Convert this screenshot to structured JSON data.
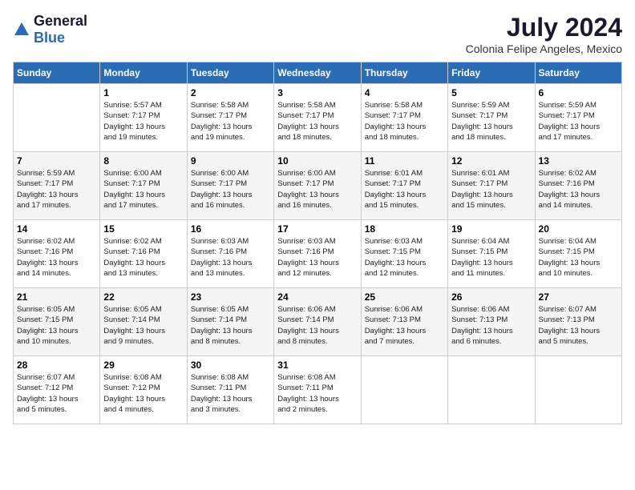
{
  "logo": {
    "general": "General",
    "blue": "Blue"
  },
  "title": "July 2024",
  "location": "Colonia Felipe Angeles, Mexico",
  "days_of_week": [
    "Sunday",
    "Monday",
    "Tuesday",
    "Wednesday",
    "Thursday",
    "Friday",
    "Saturday"
  ],
  "weeks": [
    [
      {
        "day": "",
        "info": ""
      },
      {
        "day": "1",
        "info": "Sunrise: 5:57 AM\nSunset: 7:17 PM\nDaylight: 13 hours\nand 19 minutes."
      },
      {
        "day": "2",
        "info": "Sunrise: 5:58 AM\nSunset: 7:17 PM\nDaylight: 13 hours\nand 19 minutes."
      },
      {
        "day": "3",
        "info": "Sunrise: 5:58 AM\nSunset: 7:17 PM\nDaylight: 13 hours\nand 18 minutes."
      },
      {
        "day": "4",
        "info": "Sunrise: 5:58 AM\nSunset: 7:17 PM\nDaylight: 13 hours\nand 18 minutes."
      },
      {
        "day": "5",
        "info": "Sunrise: 5:59 AM\nSunset: 7:17 PM\nDaylight: 13 hours\nand 18 minutes."
      },
      {
        "day": "6",
        "info": "Sunrise: 5:59 AM\nSunset: 7:17 PM\nDaylight: 13 hours\nand 17 minutes."
      }
    ],
    [
      {
        "day": "7",
        "info": "Sunrise: 5:59 AM\nSunset: 7:17 PM\nDaylight: 13 hours\nand 17 minutes."
      },
      {
        "day": "8",
        "info": "Sunrise: 6:00 AM\nSunset: 7:17 PM\nDaylight: 13 hours\nand 17 minutes."
      },
      {
        "day": "9",
        "info": "Sunrise: 6:00 AM\nSunset: 7:17 PM\nDaylight: 13 hours\nand 16 minutes."
      },
      {
        "day": "10",
        "info": "Sunrise: 6:00 AM\nSunset: 7:17 PM\nDaylight: 13 hours\nand 16 minutes."
      },
      {
        "day": "11",
        "info": "Sunrise: 6:01 AM\nSunset: 7:17 PM\nDaylight: 13 hours\nand 15 minutes."
      },
      {
        "day": "12",
        "info": "Sunrise: 6:01 AM\nSunset: 7:17 PM\nDaylight: 13 hours\nand 15 minutes."
      },
      {
        "day": "13",
        "info": "Sunrise: 6:02 AM\nSunset: 7:16 PM\nDaylight: 13 hours\nand 14 minutes."
      }
    ],
    [
      {
        "day": "14",
        "info": "Sunrise: 6:02 AM\nSunset: 7:16 PM\nDaylight: 13 hours\nand 14 minutes."
      },
      {
        "day": "15",
        "info": "Sunrise: 6:02 AM\nSunset: 7:16 PM\nDaylight: 13 hours\nand 13 minutes."
      },
      {
        "day": "16",
        "info": "Sunrise: 6:03 AM\nSunset: 7:16 PM\nDaylight: 13 hours\nand 13 minutes."
      },
      {
        "day": "17",
        "info": "Sunrise: 6:03 AM\nSunset: 7:16 PM\nDaylight: 13 hours\nand 12 minutes."
      },
      {
        "day": "18",
        "info": "Sunrise: 6:03 AM\nSunset: 7:15 PM\nDaylight: 13 hours\nand 12 minutes."
      },
      {
        "day": "19",
        "info": "Sunrise: 6:04 AM\nSunset: 7:15 PM\nDaylight: 13 hours\nand 11 minutes."
      },
      {
        "day": "20",
        "info": "Sunrise: 6:04 AM\nSunset: 7:15 PM\nDaylight: 13 hours\nand 10 minutes."
      }
    ],
    [
      {
        "day": "21",
        "info": "Sunrise: 6:05 AM\nSunset: 7:15 PM\nDaylight: 13 hours\nand 10 minutes."
      },
      {
        "day": "22",
        "info": "Sunrise: 6:05 AM\nSunset: 7:14 PM\nDaylight: 13 hours\nand 9 minutes."
      },
      {
        "day": "23",
        "info": "Sunrise: 6:05 AM\nSunset: 7:14 PM\nDaylight: 13 hours\nand 8 minutes."
      },
      {
        "day": "24",
        "info": "Sunrise: 6:06 AM\nSunset: 7:14 PM\nDaylight: 13 hours\nand 8 minutes."
      },
      {
        "day": "25",
        "info": "Sunrise: 6:06 AM\nSunset: 7:13 PM\nDaylight: 13 hours\nand 7 minutes."
      },
      {
        "day": "26",
        "info": "Sunrise: 6:06 AM\nSunset: 7:13 PM\nDaylight: 13 hours\nand 6 minutes."
      },
      {
        "day": "27",
        "info": "Sunrise: 6:07 AM\nSunset: 7:13 PM\nDaylight: 13 hours\nand 5 minutes."
      }
    ],
    [
      {
        "day": "28",
        "info": "Sunrise: 6:07 AM\nSunset: 7:12 PM\nDaylight: 13 hours\nand 5 minutes."
      },
      {
        "day": "29",
        "info": "Sunrise: 6:08 AM\nSunset: 7:12 PM\nDaylight: 13 hours\nand 4 minutes."
      },
      {
        "day": "30",
        "info": "Sunrise: 6:08 AM\nSunset: 7:11 PM\nDaylight: 13 hours\nand 3 minutes."
      },
      {
        "day": "31",
        "info": "Sunrise: 6:08 AM\nSunset: 7:11 PM\nDaylight: 13 hours\nand 2 minutes."
      },
      {
        "day": "",
        "info": ""
      },
      {
        "day": "",
        "info": ""
      },
      {
        "day": "",
        "info": ""
      }
    ]
  ]
}
